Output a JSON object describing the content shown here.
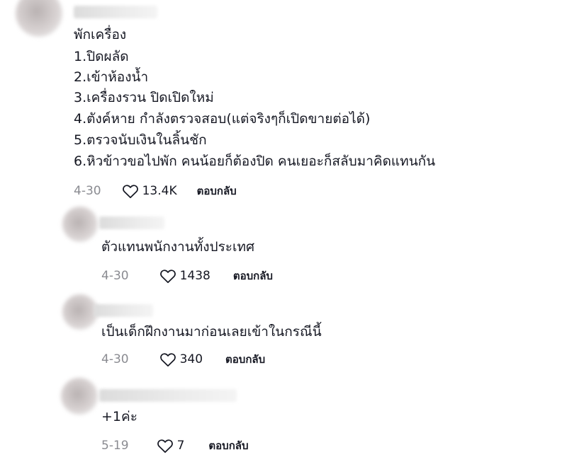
{
  "comments": [
    {
      "lines": [
        "พักเครื่อง",
        "1.ปิดผลัด",
        "2.เข้าห้องน้ำ",
        "3.เครื่องรวน ปิดเปิดใหม่",
        "4.ตังค์หาย กำลังตรวจสอบ(แต่จริงๆก็เปิดขายต่อได้)",
        "5.ตรวจนับเงินในลิ้นชัก",
        "6.หิวข้าวขอไปพัก คนน้อยก็ต้องปิด คนเยอะก็สลับมาคิดแทนกัน"
      ],
      "date": "4-30",
      "likes": "13.4K",
      "reply_label": "ตอบกลับ"
    },
    {
      "lines": [
        "ตัวแทนพนักงานทั้งประเทศ"
      ],
      "date": "4-30",
      "likes": "1438",
      "reply_label": "ตอบกลับ"
    },
    {
      "lines": [
        "เป็นเด็กฝึกงานมาก่อนเลยเข้าในกรณีนี้"
      ],
      "date": "4-30",
      "likes": "340",
      "reply_label": "ตอบกลับ"
    },
    {
      "lines": [
        "+1ค่ะ"
      ],
      "date": "5-19",
      "likes": "7",
      "reply_label": "ตอบกลับ"
    }
  ],
  "icons": {
    "like": "heart-outline-icon"
  },
  "colors": {
    "text": "#161823",
    "muted": "#8a8b91"
  }
}
